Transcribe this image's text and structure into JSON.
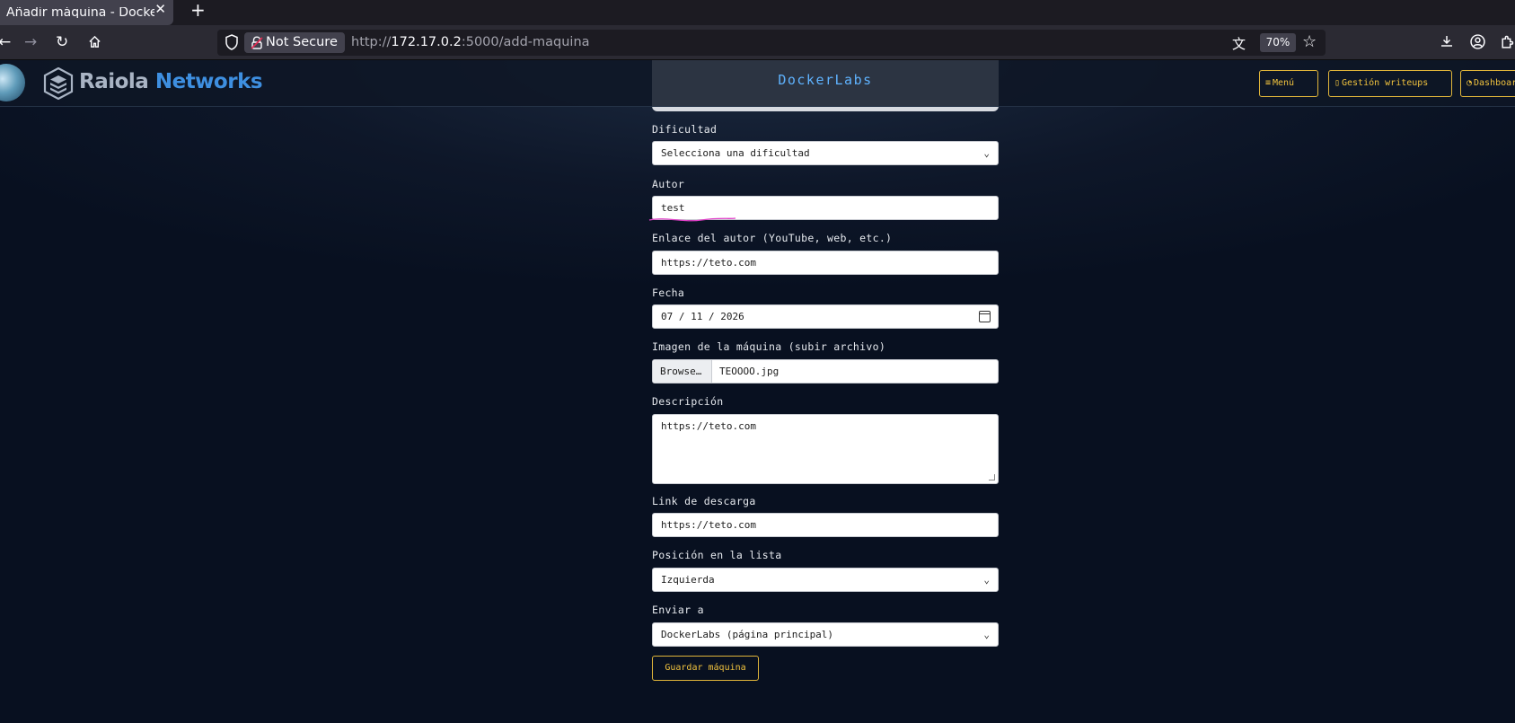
{
  "browser": {
    "tab_title": "Añadir máquina - DockerLabs",
    "tab_close": "✕",
    "new_tab": "+",
    "not_secure": "Not Secure",
    "url_prefix": "http://",
    "url_host": "172.17.0.2",
    "url_path": ":5000/add-maquina",
    "zoom": "70%"
  },
  "header": {
    "logo_part1": "Raiola",
    "logo_part2": "Networks",
    "brand": "DockerLabs",
    "menu_label": "Menú",
    "writeups_label": "Gestión writeups",
    "dashboard_label": "Dashboard"
  },
  "form": {
    "dificultad_label": "Dificultad",
    "dificultad_value": "Selecciona una dificultad",
    "autor_label": "Autor",
    "autor_value": "test",
    "enlace_label": "Enlace del autor (YouTube, web, etc.)",
    "enlace_value": "https://teto.com",
    "fecha_label": "Fecha",
    "fecha_value": "07 / 11 / 2026",
    "imagen_label": "Imagen de la máquina (subir archivo)",
    "browse_label": "Browse…",
    "imagen_value": "TEOOOO.jpg",
    "descripcion_label": "Descripción",
    "descripcion_value": "https://teto.com",
    "link_label": "Link de descarga",
    "link_value": "https://teto.com",
    "posicion_label": "Posición en la lista",
    "posicion_value": "Izquierda",
    "enviar_label": "Enviar a",
    "enviar_value": "DockerLabs (página principal)",
    "save_label": "Guardar máquina"
  },
  "colors": {
    "accent": "#f0c23e",
    "brand": "#5fb3ff",
    "annotation": "#e040c8"
  }
}
